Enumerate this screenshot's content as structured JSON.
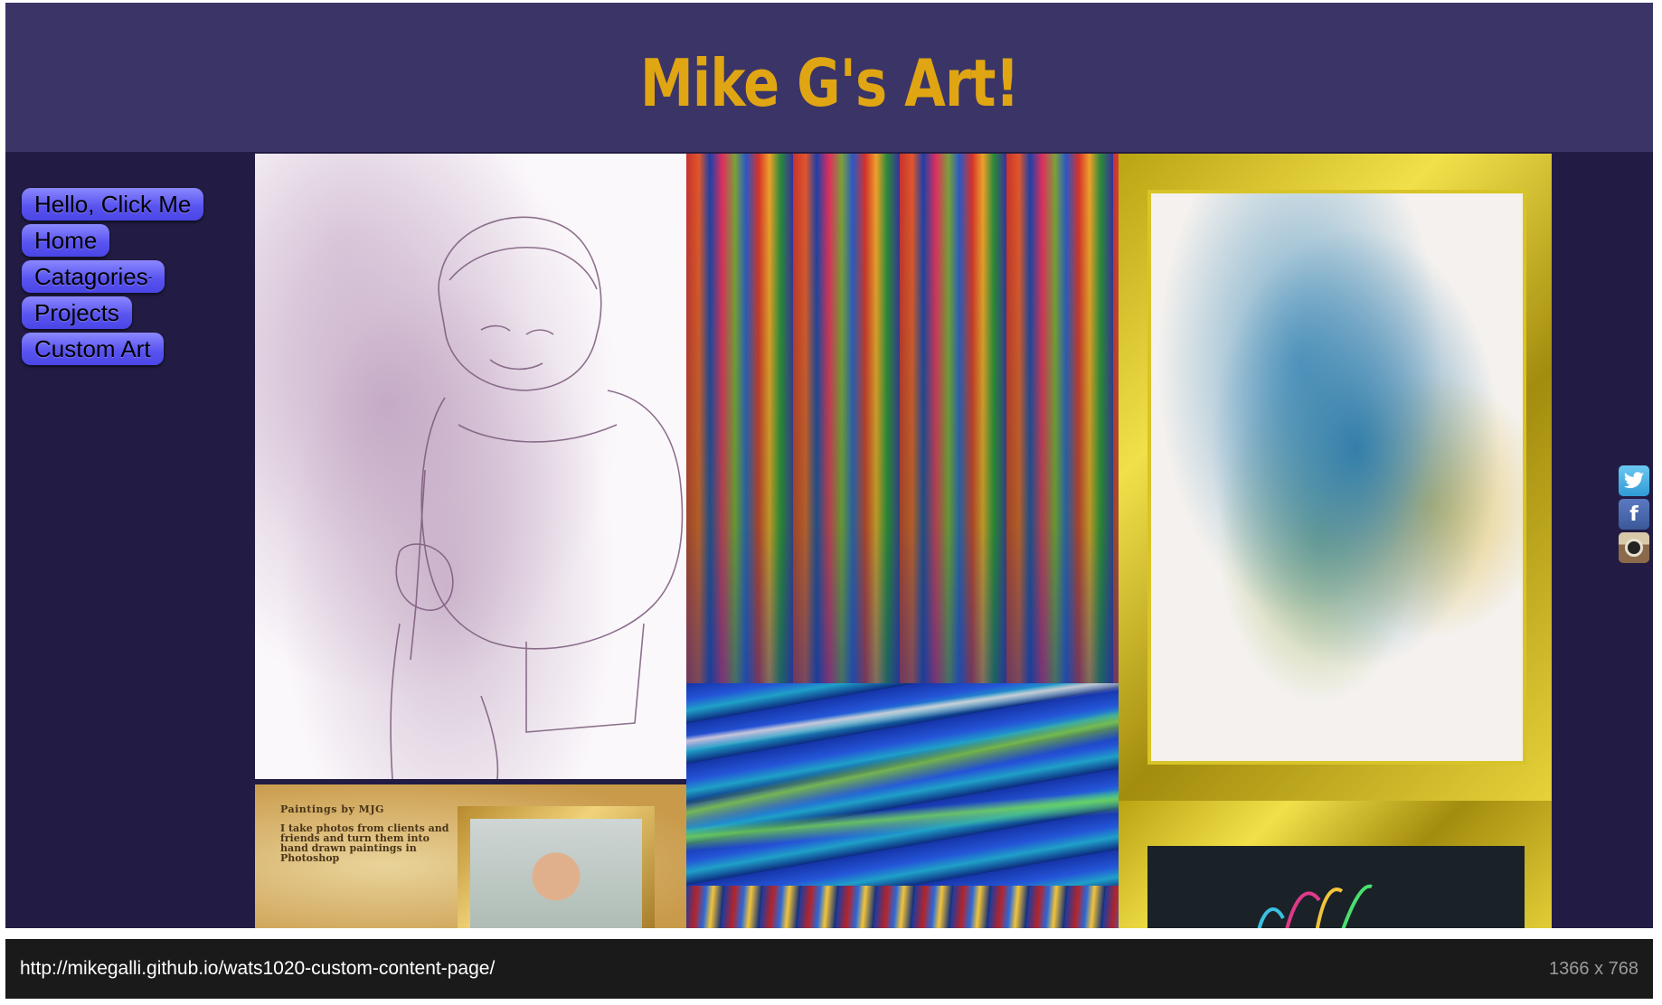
{
  "header": {
    "title": "Mike G's Art!"
  },
  "nav": {
    "items": [
      {
        "label": "Hello, Click Me"
      },
      {
        "label": "Home"
      },
      {
        "label": "Catagories"
      },
      {
        "label": "Projects"
      },
      {
        "label": "Custom Art"
      }
    ]
  },
  "gallery": {
    "parchment": {
      "title": "Paintings by MJG",
      "text": "I take photos from clients and friends and turn them into hand drawn paintings in Photoshop"
    }
  },
  "social": {
    "icons": [
      "twitter-icon",
      "facebook-icon",
      "instagram-icon"
    ],
    "facebook_glyph": "f"
  },
  "statusbar": {
    "url": "http://mikegalli.github.io/wats1020-custom-content-page/",
    "size": "1366 x 768"
  },
  "colors": {
    "header_bg": "#3a3566",
    "page_bg": "#221c44",
    "title_color": "#e0a512",
    "nav_button": "#5a55f0"
  }
}
